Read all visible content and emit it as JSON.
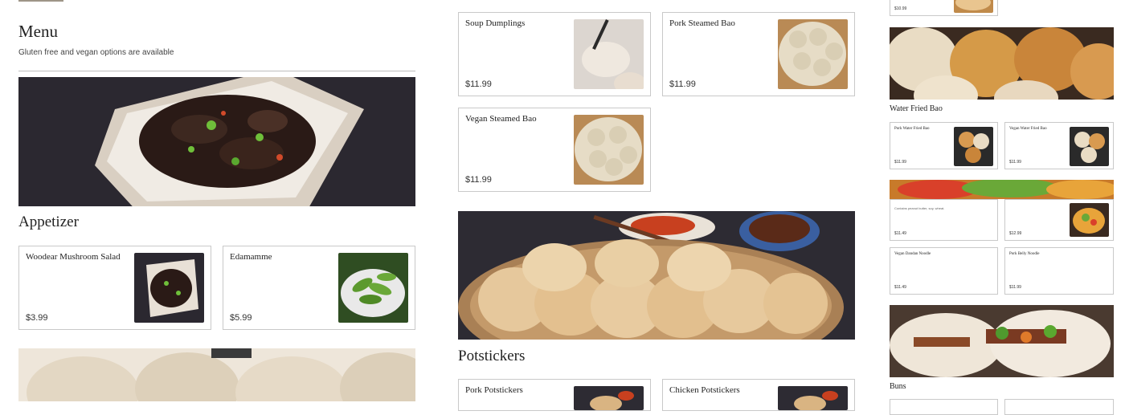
{
  "menu": {
    "title": "Menu",
    "subtitle": "Gluten free and vegan options are available"
  },
  "sections": {
    "appetizer": "Appetizer",
    "potstickers": "Potstickers",
    "water_fried_bao": "Water Fried Bao",
    "buns": "Buns"
  },
  "items": {
    "woodear": {
      "name": "Woodear Mushroom Salad",
      "price": "$3.99"
    },
    "edamame": {
      "name": "Edamamme",
      "price": "$5.99"
    },
    "soup_dumplings": {
      "name": "Soup Dumplings",
      "price": "$11.99"
    },
    "pork_steamed_bao": {
      "name": "Pork Steamed Bao",
      "price": "$11.99"
    },
    "vegan_steamed_bao": {
      "name": "Vegan Steamed Bao",
      "price": "$11.99"
    },
    "pork_potstickers": {
      "name": "Pork Potstickers"
    },
    "chicken_potstickers": {
      "name": "Chicken Potstickers"
    },
    "top_partial": {
      "price": "$10.99"
    },
    "pork_water_fried_bao": {
      "name": "Pork Water Fried Bao",
      "price": "$11.99"
    },
    "vegan_water_fried_bao": {
      "name": "Vegan Water Fried Bao",
      "price": "$11.99"
    },
    "noodle_a": {
      "note": "Contains peanut butter, soy, wheat.",
      "price": "$11.49"
    },
    "noodle_b": {
      "price": "$12.99"
    },
    "vegan_dandan": {
      "name": "Vegan Dandan Noodle",
      "price": "$11.49"
    },
    "pork_belly_noodle": {
      "name": "Pork Belly Noodle",
      "price": "$11.99"
    }
  },
  "colors": {
    "card_border": "#c9c9c9",
    "divider": "#bdbdbd",
    "text": "#222222",
    "bar_accent": "#9e9587"
  },
  "icons": [
    "mushroom-salad-photo",
    "edamame-photo",
    "dumpling-photo",
    "bao-photo",
    "potsticker-photo",
    "noodle-photo",
    "gua-bao-photo"
  ]
}
